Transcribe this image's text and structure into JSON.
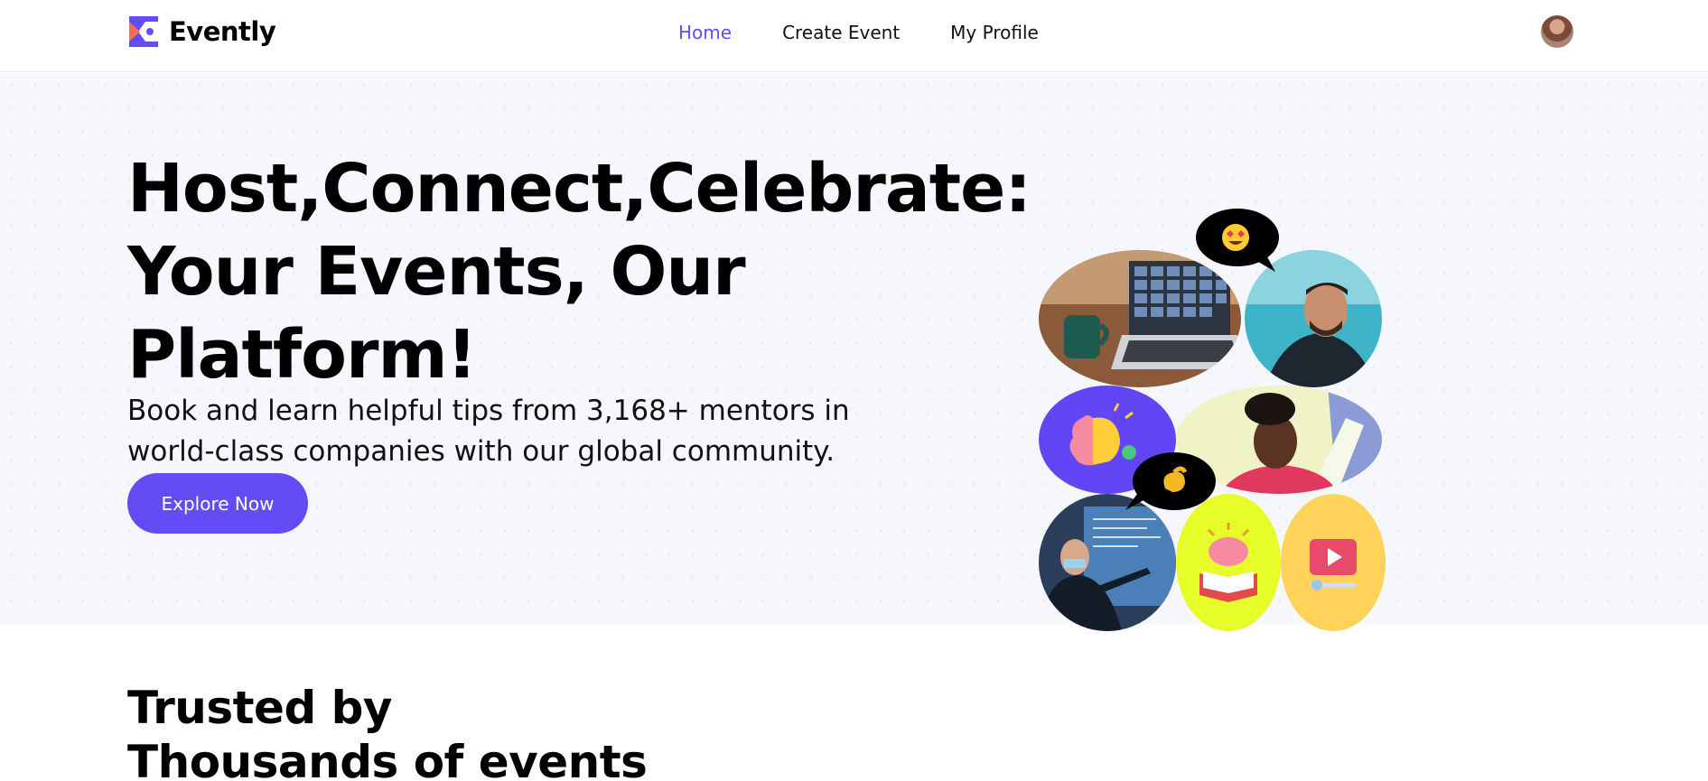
{
  "brand": {
    "name": "Evently",
    "accent": "#624cf5"
  },
  "nav": {
    "items": [
      {
        "label": "Home",
        "active": true
      },
      {
        "label": "Create Event",
        "active": false
      },
      {
        "label": "My Profile",
        "active": false
      }
    ]
  },
  "hero": {
    "title_lines": [
      "Host,Connect,Celebrate:",
      "Your Events, Our",
      "Platform!"
    ],
    "description_lines": [
      "Book and learn helpful tips from 3,168+ mentors in",
      "world-class companies with our global community."
    ],
    "cta_label": "Explore Now"
  },
  "trusted": {
    "title_lines": [
      "Trusted by",
      "Thousands of events"
    ]
  },
  "icons": {
    "avatar": "user-avatar",
    "bubble_top": "heart-eyes-emoji",
    "bubble_middle": "pinching-hand-emoji",
    "brain": "brain-lightbulb-icon",
    "book": "brain-book-icon",
    "video": "play-video-icon"
  }
}
